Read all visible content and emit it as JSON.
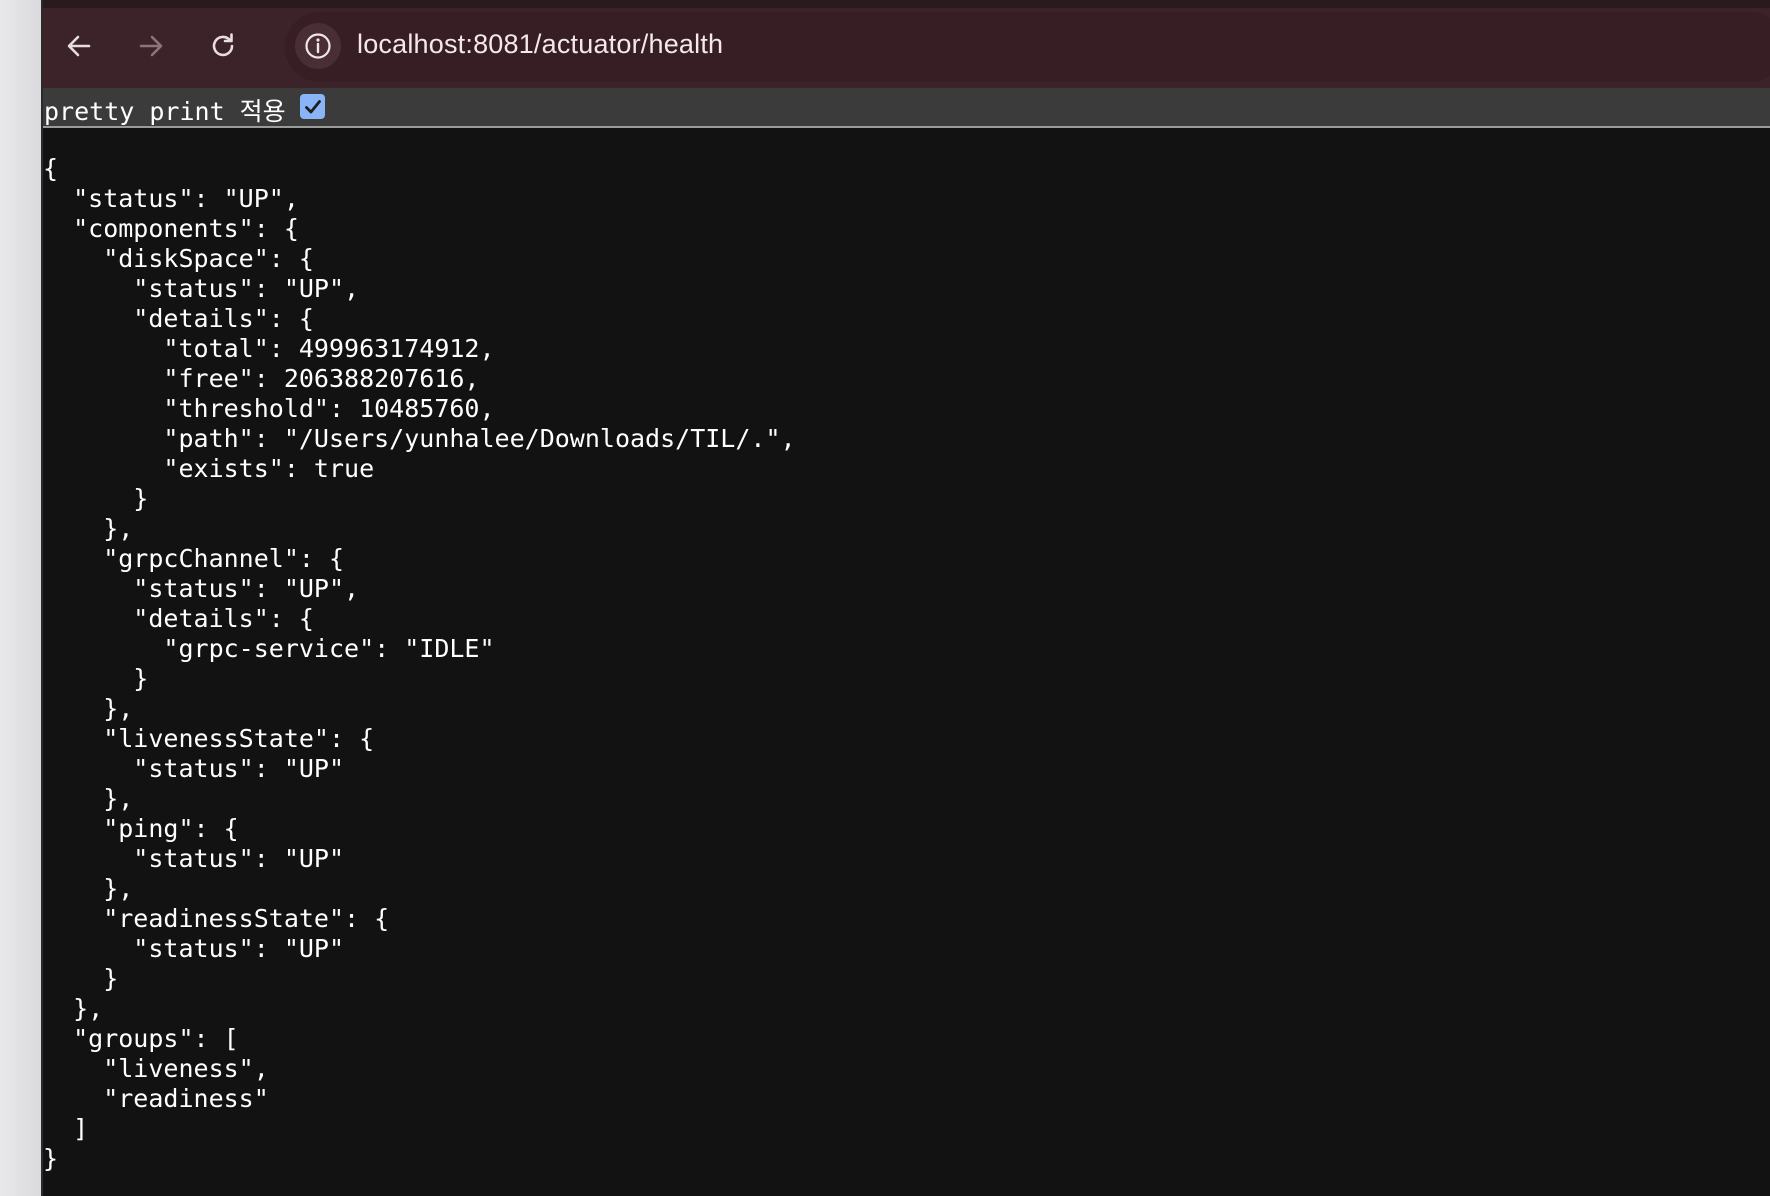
{
  "browser": {
    "back_icon": "arrow-left-icon",
    "forward_icon": "arrow-right-icon",
    "reload_icon": "reload-icon",
    "site_info_icon": "info-icon",
    "url": "localhost:8081/actuator/health"
  },
  "viewer": {
    "pretty_print_label": "pretty print 적용",
    "pretty_print_checked": true
  },
  "response": {
    "json_text": "{\n  \"status\": \"UP\",\n  \"components\": {\n    \"diskSpace\": {\n      \"status\": \"UP\",\n      \"details\": {\n        \"total\": 499963174912,\n        \"free\": 206388207616,\n        \"threshold\": 10485760,\n        \"path\": \"/Users/yunhalee/Downloads/TIL/.\",\n        \"exists\": true\n      }\n    },\n    \"grpcChannel\": {\n      \"status\": \"UP\",\n      \"details\": {\n        \"grpc-service\": \"IDLE\"\n      }\n    },\n    \"livenessState\": {\n      \"status\": \"UP\"\n    },\n    \"ping\": {\n      \"status\": \"UP\"\n    },\n    \"readinessState\": {\n      \"status\": \"UP\"\n    }\n  },\n  \"groups\": [\n    \"liveness\",\n    \"readiness\"\n  ]\n}"
  },
  "colors": {
    "toolbar_bg": "#3b2329",
    "urlbar_bg": "#371e24",
    "page_bg": "#121212",
    "checkbox_accent": "#8ab4f8"
  }
}
